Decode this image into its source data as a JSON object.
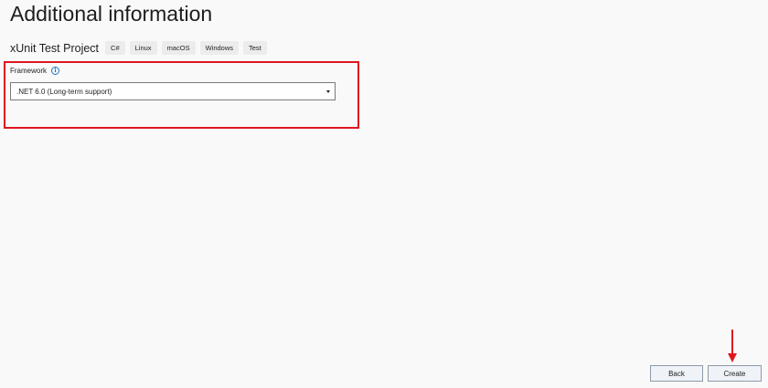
{
  "window": {
    "title": "Additional information"
  },
  "project": {
    "name": "xUnit Test Project",
    "tags": [
      "C#",
      "Linux",
      "macOS",
      "Windows",
      "Test"
    ]
  },
  "framework": {
    "label": "Framework",
    "info_icon": "info-circle-icon",
    "selected_value": ".NET 6.0 (Long-term support)"
  },
  "footer": {
    "back_label": "Back",
    "create_label": "Create"
  },
  "annotations": {
    "highlight_color": "#e0161e",
    "arrow_color": "#e0161e"
  }
}
